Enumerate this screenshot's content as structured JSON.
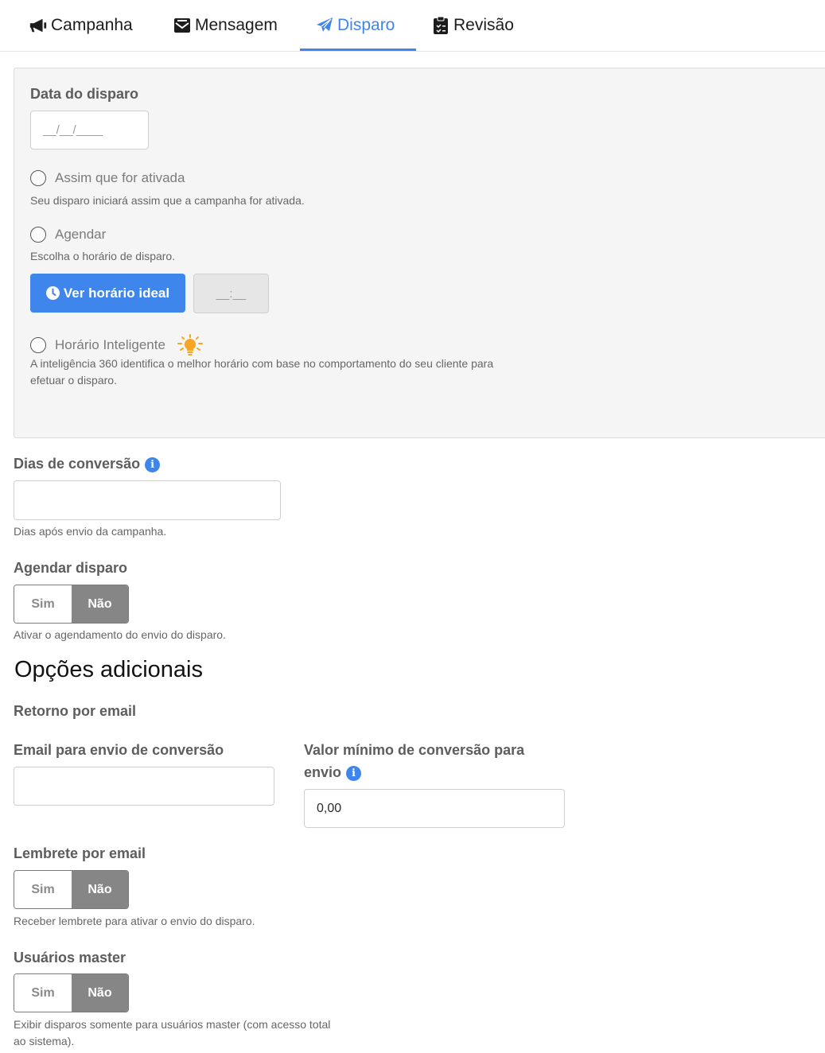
{
  "tabs": [
    {
      "label": "Campanha",
      "icon": "megaphone-icon"
    },
    {
      "label": "Mensagem",
      "icon": "envelope-icon"
    },
    {
      "label": "Disparo",
      "icon": "paper-plane-icon",
      "active": true
    },
    {
      "label": "Revisão",
      "icon": "clipboard-check-icon"
    }
  ],
  "colors": {
    "accent": "#3f86ec",
    "toggle_active": "#868686",
    "bulb": "#f6a623"
  },
  "disparo": {
    "date_label": "Data do disparo",
    "date_placeholder": "__/__/____",
    "option_now": {
      "label": "Assim que for ativada",
      "help": "Seu disparo iniciará assim que a campanha for ativada."
    },
    "option_schedule": {
      "label": "Agendar",
      "help": "Escolha o horário de disparo."
    },
    "ideal_time_button": "Ver horário ideal",
    "time_placeholder": "__:__",
    "option_smart": {
      "label": "Horário Inteligente",
      "help_line1": "A inteligência 360 identifica o melhor horário com base no comportamento do seu cliente para",
      "help_line2": "efetuar o disparo."
    }
  },
  "conversion_days": {
    "label": "Dias de conversão",
    "value": "",
    "help": "Dias após envio da campanha."
  },
  "schedule_dispatch": {
    "label": "Agendar disparo",
    "yes": "Sim",
    "no": "Não",
    "selected": "Não",
    "help": "Ativar o agendamento do envio do disparo."
  },
  "additional": {
    "title": "Opções adicionais",
    "email_return_label": "Retorno por email",
    "conversion_email": {
      "label": "Email para envio de conversão",
      "value": ""
    },
    "min_value": {
      "label_line1": "Valor mínimo de conversão para",
      "label_line2": "envio",
      "value": "0,00"
    },
    "email_reminder": {
      "label": "Lembrete por email",
      "yes": "Sim",
      "no": "Não",
      "selected": "Não",
      "help": "Receber lembrete para ativar o envio do disparo."
    },
    "master_users": {
      "label": "Usuários master",
      "yes": "Sim",
      "no": "Não",
      "selected": "Não",
      "help_line1": "Exibir disparos somente para usuários master (com acesso total",
      "help_line2": "ao sistema)."
    }
  }
}
